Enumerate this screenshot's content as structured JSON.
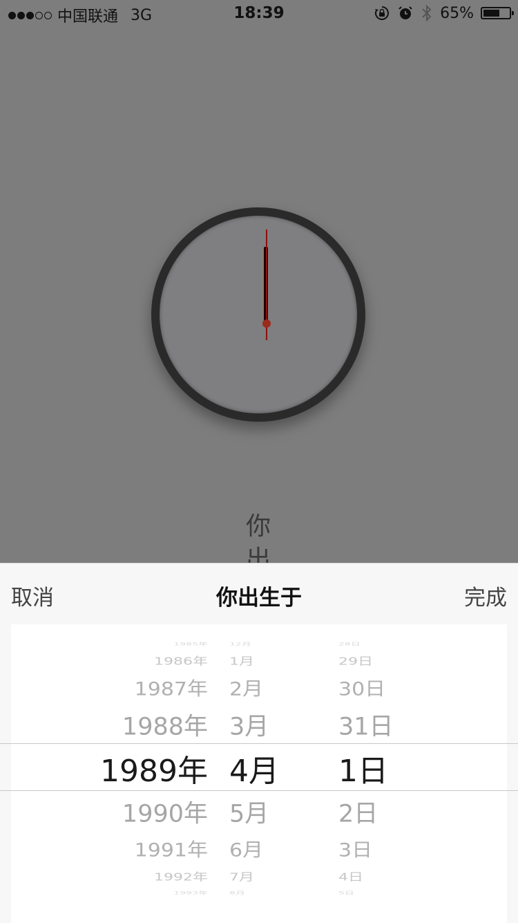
{
  "status_bar": {
    "signal_dots_filled": 3,
    "signal_dots_empty": 2,
    "carrier": "中国联通",
    "network": "3G",
    "time": "18:39",
    "battery_percent_text": "65%",
    "battery_level": 0.65
  },
  "background": {
    "partial_text": "你\n出"
  },
  "sheet": {
    "cancel_label": "取消",
    "title": "你出生于",
    "done_label": "完成"
  },
  "picker": {
    "rows": [
      {
        "year": "1985年",
        "month": "12月",
        "day": "28日"
      },
      {
        "year": "1986年",
        "month": "1月",
        "day": "29日"
      },
      {
        "year": "1987年",
        "month": "2月",
        "day": "30日"
      },
      {
        "year": "1988年",
        "month": "3月",
        "day": "31日"
      },
      {
        "year": "1989年",
        "month": "4月",
        "day": "1日"
      },
      {
        "year": "1990年",
        "month": "5月",
        "day": "2日"
      },
      {
        "year": "1991年",
        "month": "6月",
        "day": "3日"
      },
      {
        "year": "1992年",
        "month": "7月",
        "day": "4日"
      },
      {
        "year": "1993年",
        "month": "8月",
        "day": "5日"
      }
    ],
    "selected_index": 4
  }
}
